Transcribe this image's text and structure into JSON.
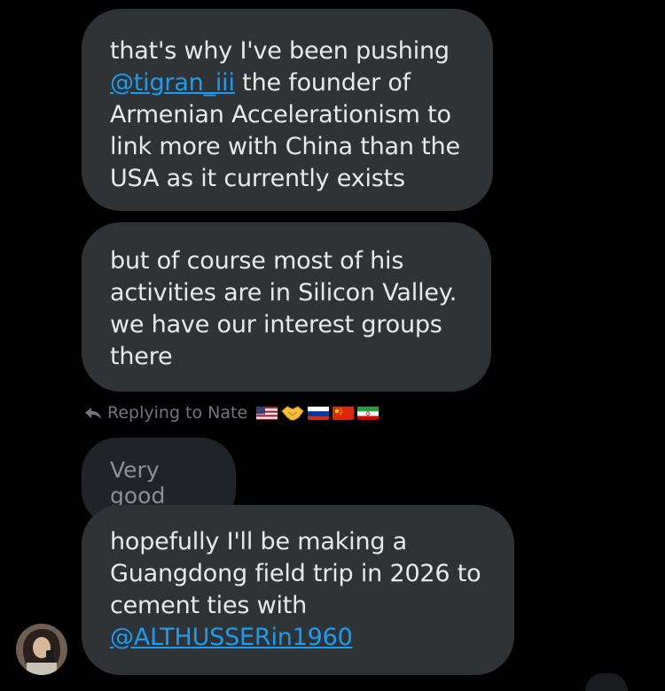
{
  "messages": [
    {
      "id": "m1",
      "parts": [
        {
          "type": "text",
          "value": "that's why I've been pushing "
        },
        {
          "type": "mention",
          "value": "@tigran_iii"
        },
        {
          "type": "text",
          "value": " the founder of Armenian Accelerationism to link more with China than the USA as it currently exists"
        }
      ]
    },
    {
      "id": "m2",
      "text": "but of course most of his activities are in Silicon Valley. we have our interest groups there"
    },
    {
      "id": "m3",
      "parts": [
        {
          "type": "text",
          "value": "hopefully I'll be making a Guangdong field trip in 2026 to cement ties with "
        },
        {
          "type": "mention",
          "value": "@ALTHUSSERin1960"
        }
      ]
    }
  ],
  "reply_context": {
    "label": "Replying to Nate",
    "icon": "reply-arrow-icon",
    "flags": [
      "us-flag",
      "handshake",
      "russia-flag",
      "china-flag",
      "iran-flag"
    ]
  },
  "quoted_message": {
    "text": "Very good"
  },
  "colors": {
    "background": "#000000",
    "bubble": "#2f3336",
    "quoted_bubble": "#202327",
    "text": "#e7e9ea",
    "muted": "#71767b",
    "link": "#1d9bf0"
  }
}
